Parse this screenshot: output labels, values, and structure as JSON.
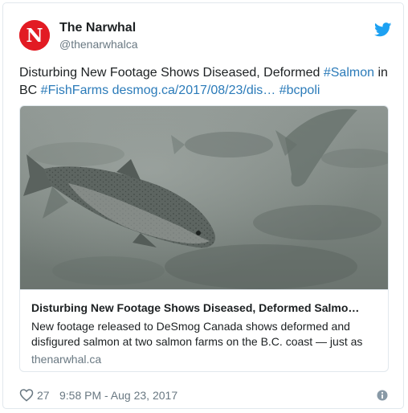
{
  "author": {
    "name": "The Narwhal",
    "handle": "@thenarwhalca",
    "avatar_letter": "N",
    "avatar_color": "#e21b23"
  },
  "tweet": {
    "segments": [
      {
        "text": "Disturbing New Footage Shows Diseased, Deformed ",
        "type": "text"
      },
      {
        "text": "#Salmon",
        "type": "hashtag"
      },
      {
        "text": " in BC ",
        "type": "text"
      },
      {
        "text": "#FishFarms",
        "type": "hashtag"
      },
      {
        "text": " ",
        "type": "text"
      },
      {
        "text": "desmog.ca/2017/08/23/dis…",
        "type": "link"
      },
      {
        "text": " ",
        "type": "text"
      },
      {
        "text": "#bcpoli",
        "type": "hashtag"
      }
    ]
  },
  "card": {
    "title": "Disturbing New Footage Shows Diseased, Deformed Salmo…",
    "description": "New footage released to DeSmog Canada shows deformed and disfigured salmon at two salmon farms on the B.C. coast — just as",
    "domain": "thenarwhal.ca"
  },
  "footer": {
    "like_count": "27",
    "timestamp": "9:58 PM - Aug 23, 2017"
  },
  "icons": {
    "brand": "twitter-bird-icon",
    "like": "heart-icon",
    "info": "info-icon"
  },
  "colors": {
    "link": "#2b7bb9",
    "twitter_blue": "#1da1f2",
    "muted": "#697882",
    "border": "#e1e8ed"
  }
}
